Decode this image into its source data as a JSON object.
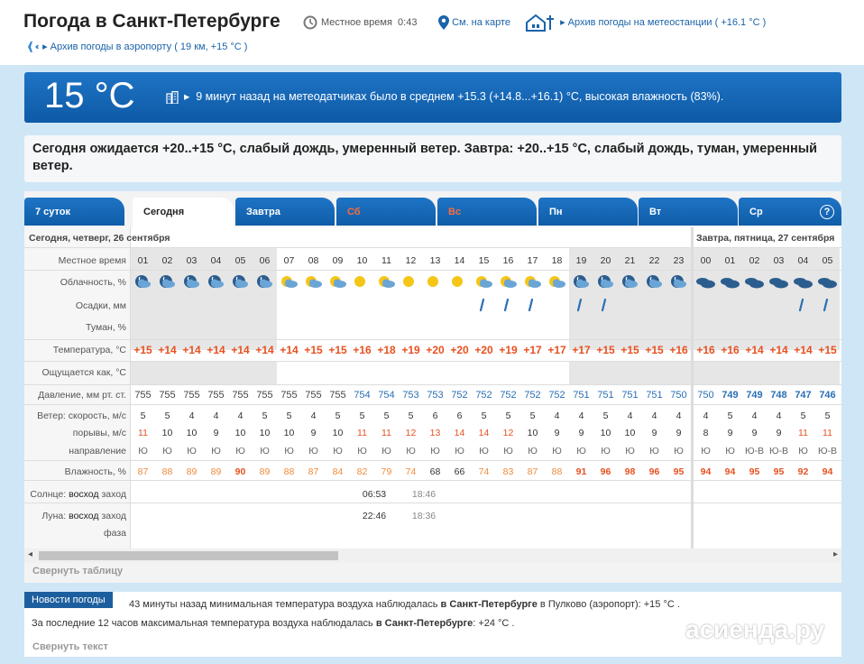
{
  "header": {
    "title": "Погода в Санкт-Петербурге",
    "local_time_label": "Местное время",
    "local_time": "0:43",
    "map_link": "См. на карте",
    "station_archive": "Архив погоды на метеостанции",
    "station_temp": "( +16.1 °C )",
    "airport_archive": "Архив погоды в аэропорту",
    "airport_info": "( 19 км, +15 °C )"
  },
  "current": {
    "temp": "15 °C",
    "text": "9 минут назад на метеодатчиках было в среднем +15.3 (+14.8...+16.1) °C, высокая влажность (83%)."
  },
  "forecast_text": "Сегодня ожидается +20..+15 °C, слабый дождь, умеренный ветер. Завтра: +20..+15 °C, слабый дождь, туман, умеренный ветер.",
  "tabs": [
    "7 суток",
    "Сегодня",
    "Завтра",
    "Сб",
    "Вс",
    "Пн",
    "Вт",
    "Ср"
  ],
  "help": "?",
  "dates": {
    "today": "Сегодня, четверг, 26 сентября",
    "tomorrow": "Завтра, пятница, 27 сентября"
  },
  "labels": {
    "time": "Местное время",
    "cloud": "Облачность, %",
    "precip": "Осадки, мм",
    "fog": "Туман, %",
    "temp": "Температура, °C",
    "feels": "Ощущается как, °C",
    "pressure": "Давление, мм рт. ст.",
    "wind": "Ветер: скорость, м/с",
    "gusts": "порывы, м/с",
    "dir": "направление",
    "humidity": "Влажность, %",
    "sun": "Солнце:",
    "sun_rise": "восход",
    "sun_set": "заход",
    "moon": "Луна:",
    "moon_rise": "восход",
    "moon_set": "заход",
    "phase": "фаза"
  },
  "hours": [
    "01",
    "02",
    "03",
    "04",
    "05",
    "06",
    "07",
    "08",
    "09",
    "10",
    "11",
    "12",
    "13",
    "14",
    "15",
    "16",
    "17",
    "18",
    "19",
    "20",
    "21",
    "22",
    "23",
    "00",
    "01",
    "02",
    "03",
    "04",
    "05"
  ],
  "cloud_icons": [
    "night-cloud",
    "night-cloud",
    "night-cloud",
    "night-cloud",
    "night-clouds",
    "night-clouds",
    "sun-cloud",
    "sun-cloud",
    "sun-cloud",
    "sun",
    "sun-clouds",
    "sun",
    "sun",
    "sun",
    "sun-clouds-rain",
    "sun-clouds-rain",
    "sun-cloud-rain",
    "sun-cloud",
    "night-cloud-rain",
    "night-cloud-rain",
    "night-cloud",
    "night-cloud",
    "night-clouds",
    "clouds",
    "clouds",
    "clouds",
    "clouds",
    "clouds-rain",
    "clouds-rain"
  ],
  "temperature": [
    "+15",
    "+14",
    "+14",
    "+14",
    "+14",
    "+14",
    "+14",
    "+15",
    "+15",
    "+16",
    "+18",
    "+19",
    "+20",
    "+20",
    "+20",
    "+19",
    "+17",
    "+17",
    "+17",
    "+15",
    "+15",
    "+15",
    "+16",
    "+16",
    "+16",
    "+14",
    "+14",
    "+14",
    "+15"
  ],
  "pressure": [
    "755",
    "755",
    "755",
    "755",
    "755",
    "755",
    "755",
    "755",
    "755",
    "754",
    "754",
    "753",
    "753",
    "752",
    "752",
    "752",
    "752",
    "752",
    "751",
    "751",
    "751",
    "751",
    "750",
    "750",
    "749",
    "749",
    "748",
    "747",
    "746"
  ],
  "wind": [
    "5",
    "5",
    "4",
    "4",
    "4",
    "5",
    "5",
    "4",
    "5",
    "5",
    "5",
    "5",
    "6",
    "6",
    "5",
    "5",
    "5",
    "4",
    "4",
    "5",
    "4",
    "4",
    "4",
    "4",
    "5",
    "4",
    "4",
    "5",
    "5"
  ],
  "gusts": [
    "11",
    "10",
    "10",
    "9",
    "10",
    "10",
    "10",
    "9",
    "10",
    "11",
    "11",
    "12",
    "13",
    "14",
    "14",
    "12",
    "10",
    "9",
    "9",
    "10",
    "10",
    "9",
    "9",
    "8",
    "9",
    "9",
    "9",
    "11",
    "11"
  ],
  "direction": [
    "Ю",
    "Ю",
    "Ю",
    "Ю",
    "Ю",
    "Ю",
    "Ю",
    "Ю",
    "Ю",
    "Ю",
    "Ю",
    "Ю",
    "Ю",
    "Ю",
    "Ю",
    "Ю",
    "Ю",
    "Ю",
    "Ю",
    "Ю",
    "Ю",
    "Ю",
    "Ю",
    "Ю",
    "Ю",
    "Ю-В",
    "Ю-В",
    "Ю",
    "Ю-В"
  ],
  "humidity": [
    "87",
    "88",
    "89",
    "89",
    "90",
    "89",
    "88",
    "87",
    "84",
    "82",
    "79",
    "74",
    "68",
    "66",
    "74",
    "83",
    "87",
    "88",
    "91",
    "96",
    "98",
    "96",
    "95",
    "94",
    "94",
    "95",
    "95",
    "92",
    "94"
  ],
  "sun": {
    "rise": "06:53",
    "set": "18:46"
  },
  "moon": {
    "rise": "22:46",
    "set": "18:36"
  },
  "scroll_left": "◂",
  "scroll_right": "▸",
  "collapse_table": "Свернуть таблицу",
  "news": {
    "badge": "Новости погоды",
    "line1_a": "43 минуты назад минимальная температура воздуха наблюдалась ",
    "line1_b": "в Санкт-Петербурге",
    "line1_c": " в Пулково (аэропорт): +15 °C .",
    "line2_a": "За последние 12 часов максимальная температура воздуха наблюдалась ",
    "line2_b": "в Санкт-Петербурге",
    "line2_c": ": +24 °C .",
    "collapse": "Свернуть текст"
  },
  "watermark": "асиенда.ру",
  "colors": {
    "accent": "#1f74c5",
    "temp": "#e8501f",
    "weekend": "#ff6a3b",
    "badge": "#1d5f9e"
  }
}
